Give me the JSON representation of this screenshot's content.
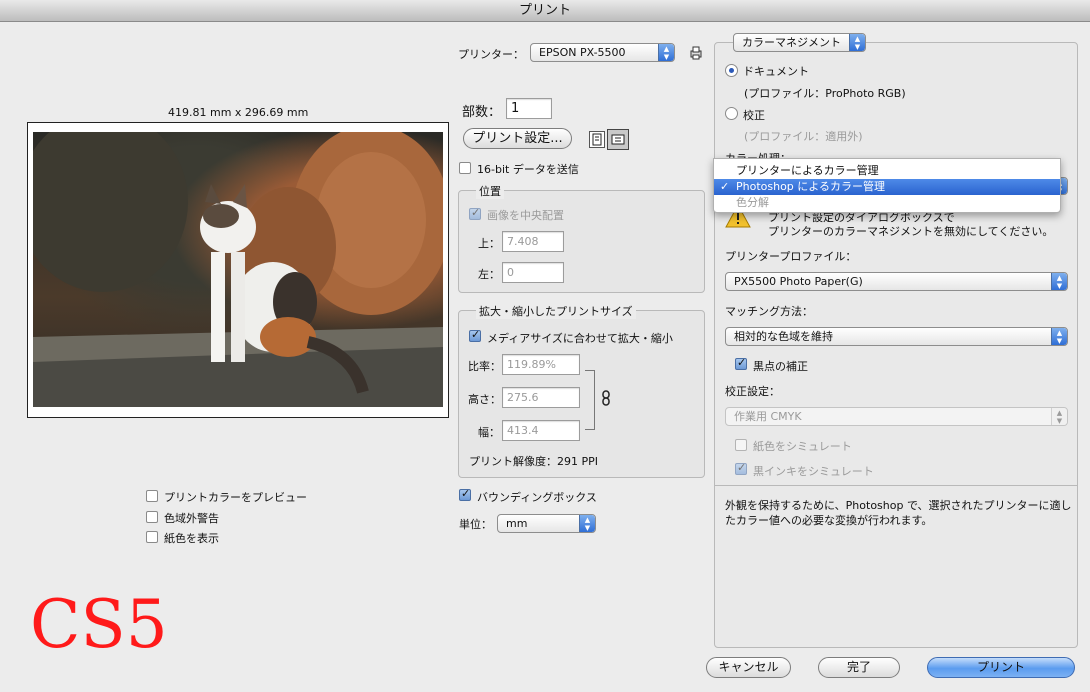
{
  "window": {
    "title": "プリント"
  },
  "preview": {
    "dimensions": "419.81 mm x 296.69 mm"
  },
  "printer": {
    "label": "プリンター：",
    "value": "EPSON PX-5500"
  },
  "copies": {
    "label": "部数：",
    "value": "1"
  },
  "print_settings_button": "プリント設定...",
  "send_16bit": {
    "label": "16-bit データを送信",
    "checked": false
  },
  "position": {
    "title": "位置",
    "center_label": "画像を中央配置",
    "top_label": "上：",
    "top_value": "7.408",
    "left_label": "左：",
    "left_value": "0"
  },
  "scaled": {
    "title": "拡大・縮小したプリントサイズ",
    "fit_media_label": "メディアサイズに合わせて拡大・縮小",
    "scale_label": "比率：",
    "scale_value": "119.89%",
    "height_label": "高さ：",
    "height_value": "275.6",
    "width_label": "幅：",
    "width_value": "413.4",
    "resolution": "プリント解像度：291 PPI"
  },
  "bounding_box": {
    "label": "バウンディングボックス",
    "checked": true
  },
  "units": {
    "label": "単位：",
    "value": "mm"
  },
  "left_options": [
    {
      "label": "プリントカラーをプレビュー",
      "checked": false
    },
    {
      "label": "色域外警告",
      "checked": false
    },
    {
      "label": "紙色を表示",
      "checked": false
    }
  ],
  "color_management": {
    "mode": "カラーマネジメント",
    "document_label": "ドキュメント",
    "document_profile": "(プロファイル：ProPhoto RGB)",
    "proof_label": "校正",
    "proof_profile": "(プロファイル：適用外)",
    "color_handling_label": "カラー処理：",
    "warning_line1": "プリント設定のダイアログボックスで",
    "warning_line2": "プリンターのカラーマネジメントを無効にしてください。",
    "menu_items": [
      "プリンターによるカラー管理",
      "Photoshop によるカラー管理",
      "色分解"
    ],
    "menu_selected": "Photoshop によるカラー管理",
    "menu_check": "✓",
    "printer_profile_label": "プリンタープロファイル：",
    "printer_profile_value": "PX5500 Photo Paper(G)",
    "matching_label": "マッチング方法：",
    "matching_value": "相対的な色域を維持",
    "black_point_label": "黒点の補正",
    "proof_setup_label": "校正設定：",
    "proof_setup_value": "作業用 CMYK",
    "simulate_paper": "紙色をシミュレート",
    "simulate_black": "黒インキをシミュレート",
    "description_line1": "外観を保持するために、Photoshop で、選択されたプリンターに適し",
    "description_line2": "たカラー値への必要な変換が行われます。"
  },
  "buttons": {
    "cancel": "キャンセル",
    "done": "完了",
    "print": "プリント"
  },
  "overlay_text": "CS5"
}
